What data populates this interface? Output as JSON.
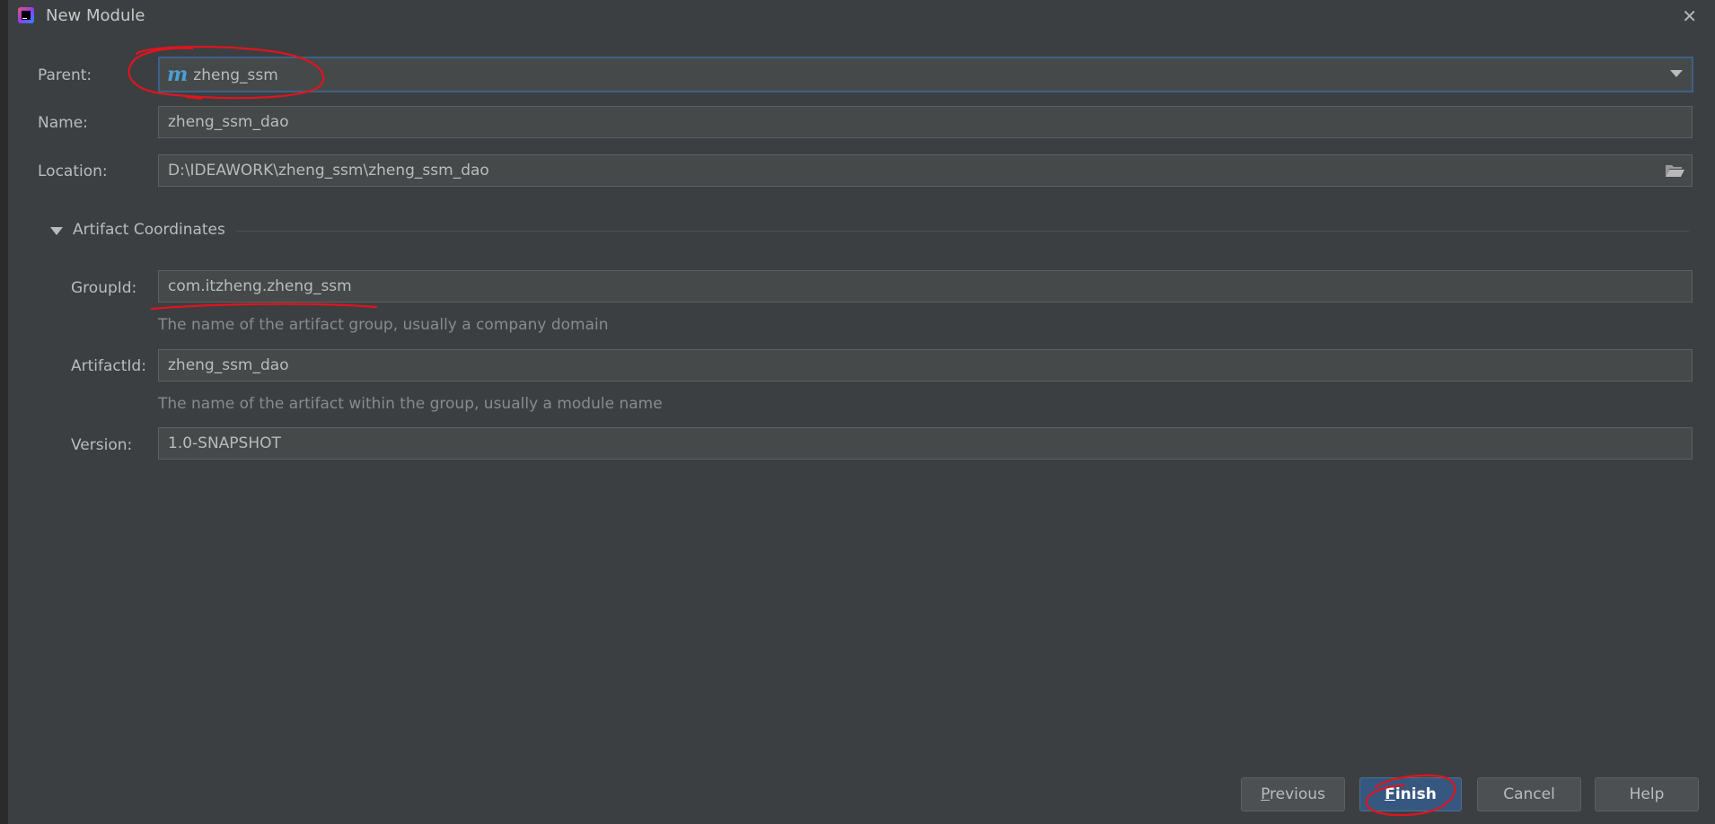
{
  "window": {
    "title": "New Module"
  },
  "form": {
    "parent_label": "Parent:",
    "parent_value": "zheng_ssm",
    "parent_icon_letter": "m",
    "name_label": "Name:",
    "name_value": "zheng_ssm_dao",
    "location_label": "Location:",
    "location_value": "D:\\IDEAWORK\\zheng_ssm\\zheng_ssm_dao"
  },
  "artifact": {
    "section_title": "Artifact Coordinates",
    "groupid_label": "GroupId:",
    "groupid_value": "com.itzheng.zheng_ssm",
    "groupid_hint": "The name of the artifact group, usually a company domain",
    "artifactid_label": "ArtifactId:",
    "artifactid_value": "zheng_ssm_dao",
    "artifactid_hint": "The name of the artifact within the group, usually a module name",
    "version_label": "Version:",
    "version_value": "1.0-SNAPSHOT"
  },
  "buttons": {
    "previous_mnemonic": "P",
    "previous_rest": "revious",
    "finish_mnemonic": "F",
    "finish_rest": "inish",
    "cancel": "Cancel",
    "help": "Help"
  },
  "colors": {
    "background": "#3c3f41",
    "field_bg": "#45494a",
    "focus_border": "#3d6185",
    "primary_button": "#365880",
    "annotation_red": "#e0141e",
    "maven_blue": "#4b9fd5"
  },
  "icons": {
    "app": "intellij-icon",
    "close": "close-icon",
    "dropdown": "chevron-down-icon",
    "folder": "folder-open-icon",
    "collapse": "triangle-down-icon",
    "maven": "maven-module-icon"
  }
}
